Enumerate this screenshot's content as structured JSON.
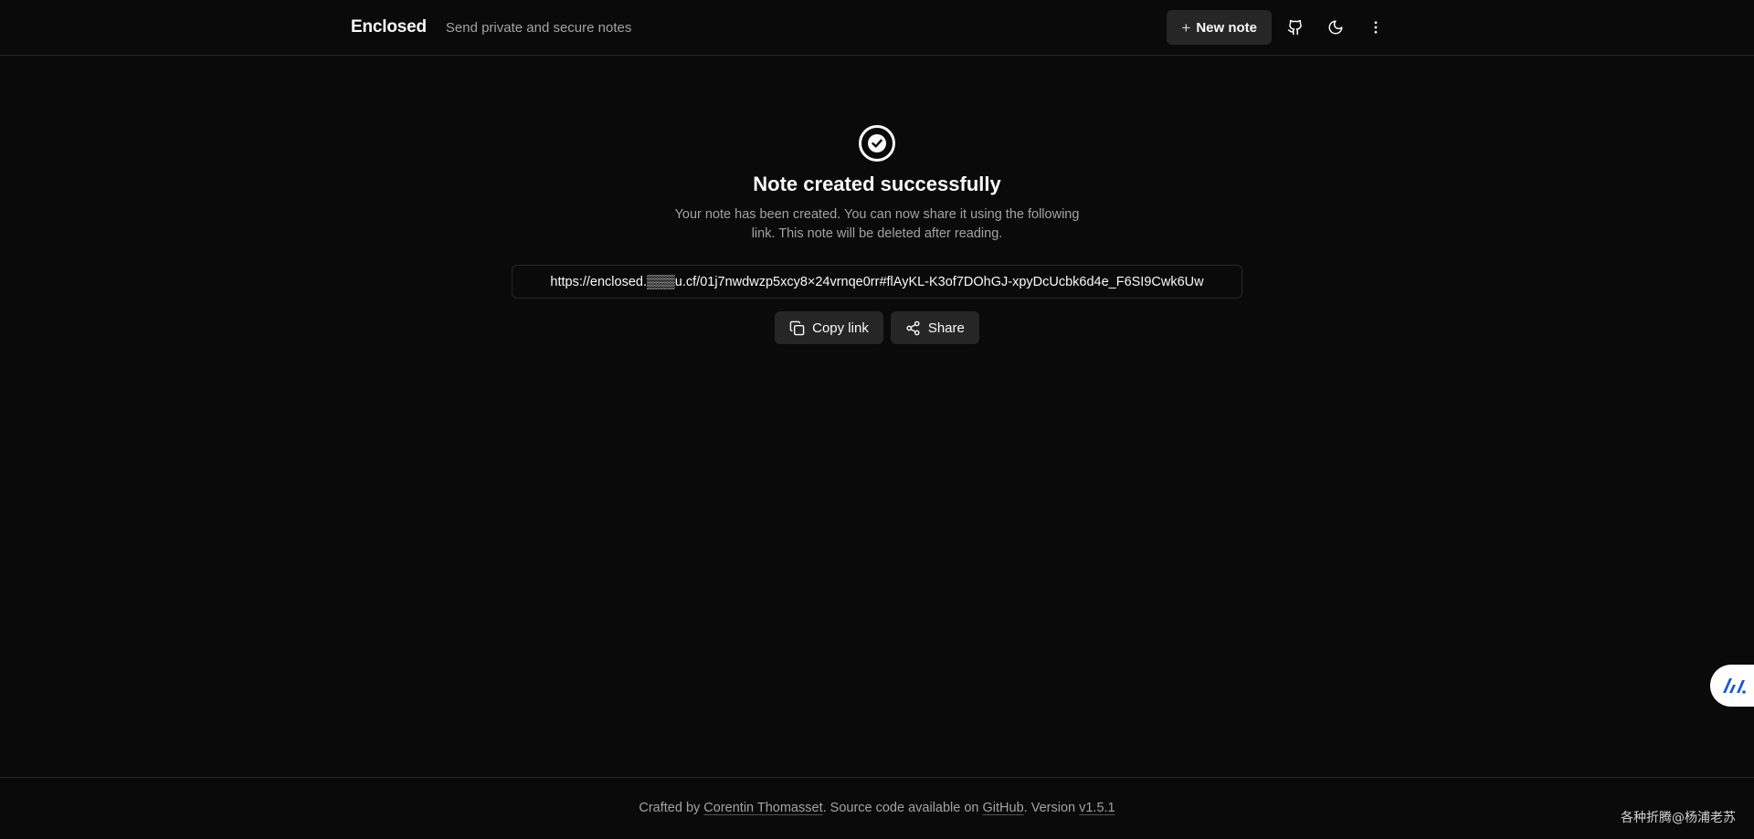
{
  "header": {
    "brand": "Enclosed",
    "tagline": "Send private and secure notes",
    "new_note_label": "New note"
  },
  "icons": {
    "plus": "plus-icon",
    "github": "github-icon",
    "theme": "moon-icon",
    "menu": "more-vertical-icon",
    "success": "check-circle-icon",
    "copy": "copy-icon",
    "share": "share-icon",
    "widget": "ai-assistant-icon"
  },
  "main": {
    "title": "Note created successfully",
    "description": "Your note has been created. You can now share it using the following link. This note will be deleted after reading.",
    "link": "https://enclosed.▒▒▒u.cf/01j7nwdwzp5xcy8×24vrnqe0rr#flAyKL-K3of7DOhGJ-xpyDcUcbk6d4e_F6SI9Cwk6Uw",
    "copy_label": "Copy link",
    "share_label": "Share"
  },
  "footer": {
    "prefix": "Crafted by ",
    "author": "Corentin Thomasset",
    "middle": ". Source code available on ",
    "source": "GitHub",
    "version_prefix": ". Version ",
    "version": "v1.5.1",
    "watermark": "各种折腾@杨浦老苏"
  },
  "colors": {
    "background": "#0a0a0a",
    "surface": "#262626",
    "border": "#262626",
    "text": "#fafafa",
    "muted": "#a3a3a3",
    "widget_accent": "#1a56db"
  }
}
